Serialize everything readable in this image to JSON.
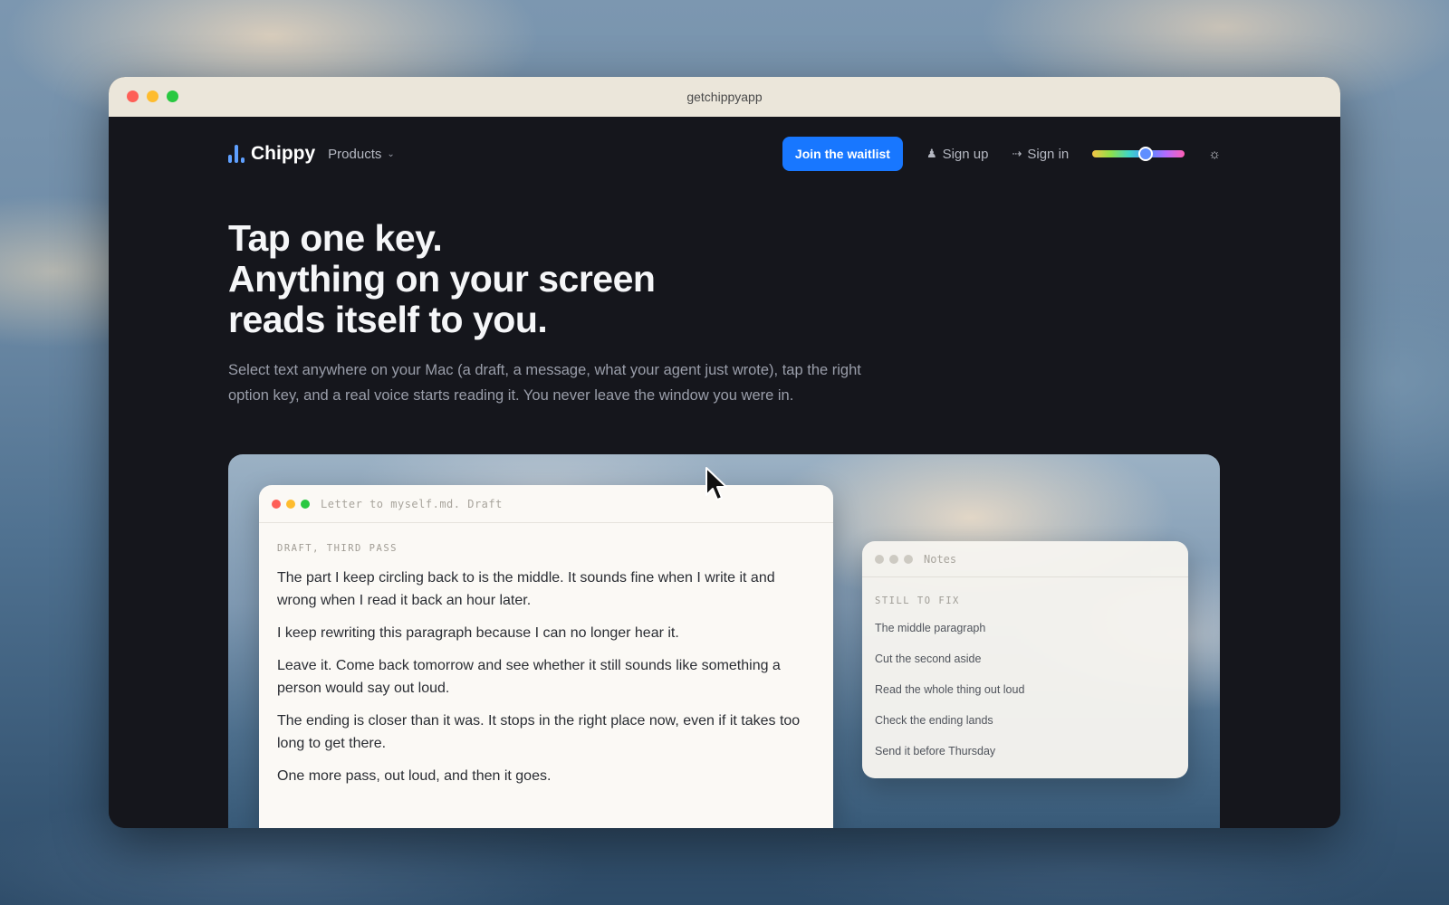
{
  "window": {
    "url": "getchippyapp"
  },
  "nav": {
    "brand": "Chippy",
    "products_label": "Products",
    "waitlist_label": "Join the waitlist",
    "signup_label": "Sign up",
    "signin_label": "Sign in",
    "color_slider_level": 0.58,
    "icons": {
      "logo": "bar-chart-icon",
      "products_chevron": "chevron-down-icon",
      "signup": "user-plus-icon",
      "signin": "sign-in-icon",
      "theme": "sun-icon"
    }
  },
  "hero": {
    "title_lines": [
      "Tap one key.",
      "Anything on your screen",
      "reads itself to you."
    ],
    "subtitle": "Select text anywhere on your Mac (a draft, a message, what your agent just wrote), tap the right option key, and a real voice starts reading it. You never leave the window you were in."
  },
  "doc_window": {
    "title": "Letter to myself.md. Draft",
    "eyebrow": "DRAFT, THIRD PASS",
    "paragraphs": [
      "The part I keep circling back to is the middle. It sounds fine when I write it and wrong when I read it back an hour later.",
      "I keep rewriting this paragraph because I can no longer hear it.",
      "Leave it. Come back tomorrow and see whether it still sounds like something a person would say out loud.",
      "The ending is closer than it was. It stops in the right place now, even if it takes too long to get there.",
      "One more pass, out loud, and then it goes."
    ]
  },
  "notes_window": {
    "title": "Notes",
    "eyebrow": "STILL TO FIX",
    "items": [
      "The middle paragraph",
      "Cut the second aside",
      "Read the whole thing out loud",
      "Check the ending lands",
      "Send it before Thursday"
    ]
  },
  "colors": {
    "accent": "#1877ff",
    "page_bg": "#15161c"
  }
}
